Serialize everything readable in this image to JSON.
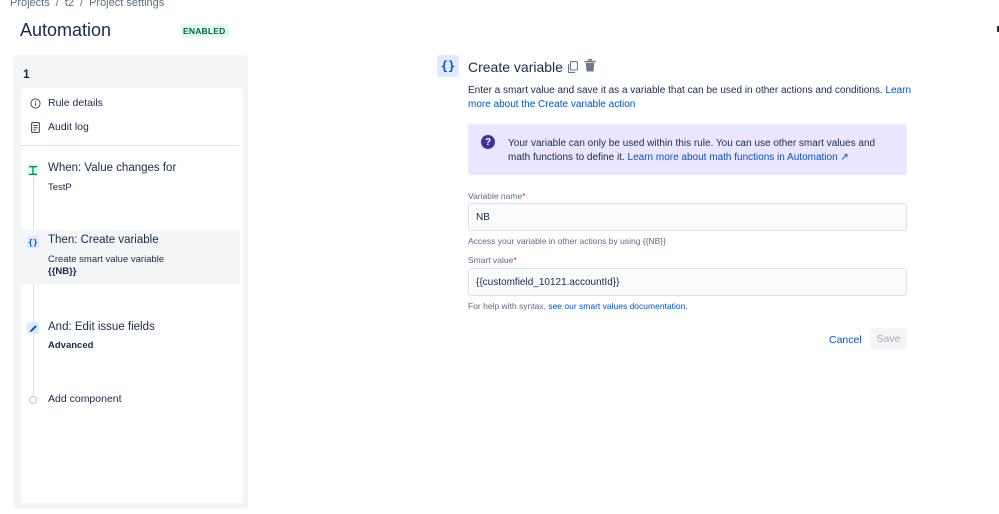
{
  "breadcrumb": {
    "items": [
      "Projects",
      "t2",
      "Project settings"
    ],
    "separator": "/"
  },
  "header": {
    "title": "Automation",
    "status": "ENABLED"
  },
  "sidebar": {
    "rule_number": "1",
    "nav": [
      {
        "label": "Rule details",
        "icon": "info-icon"
      },
      {
        "label": "Audit log",
        "icon": "document-icon"
      }
    ],
    "steps": [
      {
        "title": "When: Value changes for",
        "subtitle": "TestP",
        "icon": "trigger-icon"
      },
      {
        "title": "Then: Create variable",
        "subtitle": "Create smart value variable",
        "subtitle2": "{{NB}}",
        "icon": "curly-braces-icon"
      },
      {
        "title": "And: Edit issue fields",
        "subtitle": "Advanced",
        "icon": "pencil-icon"
      }
    ],
    "add_component": "Add component"
  },
  "detail": {
    "icon_glyph": "{}",
    "title": "Create variable",
    "description": "Enter a smart value and save it as a variable that can be used in other actions and conditions.",
    "description_link": "Learn more about the Create variable action",
    "info": {
      "text": "Your variable can only be used within this rule. You can use other smart values and math functions to define it.",
      "link": "Learn more about math functions in Automation ↗"
    },
    "variable_name": {
      "label": "Variable name",
      "required": "*",
      "value": "NB",
      "helper": "Access your variable in other actions by using {{NB}}"
    },
    "smart_value": {
      "label": "Smart value",
      "required": "*",
      "value": "{{customfield_10121.accountId}}",
      "helper_prefix": "For help with syntax,",
      "helper_link": "see our smart values documentation."
    },
    "cancel_label": "Cancel",
    "save_label": "Save"
  },
  "colors": {
    "accent": "#0052cc",
    "enabled_badge_bg": "#e3fcef",
    "enabled_badge_text": "#006644",
    "info_bg": "#eae6ff"
  }
}
